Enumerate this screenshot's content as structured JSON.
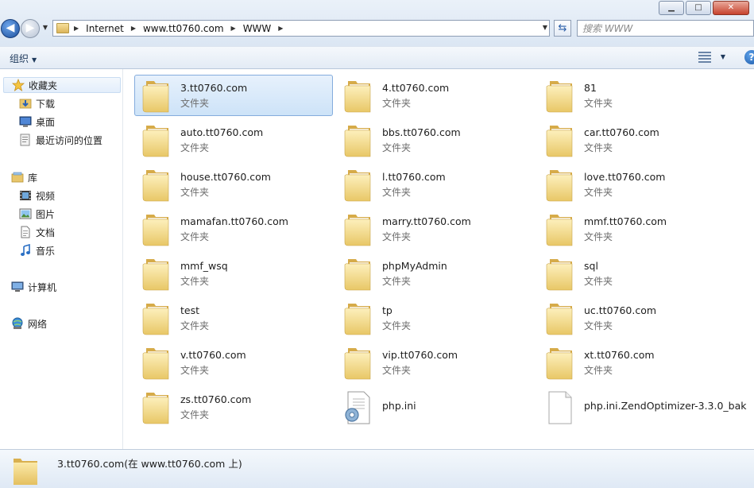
{
  "address_bar": {
    "breadcrumbs": [
      "Internet",
      "www.tt0760.com",
      "WWW"
    ],
    "search_placeholder": "搜索 WWW"
  },
  "toolbar": {
    "organize_label": "组织"
  },
  "sidebar": {
    "items": [
      {
        "label": "收藏夹",
        "icon": "star-icon"
      },
      {
        "label": "下载",
        "icon": "download-folder-icon"
      },
      {
        "label": "桌面",
        "icon": "desktop-icon"
      },
      {
        "label": "最近访问的位置",
        "icon": "recent-places-icon"
      },
      {
        "label": "库",
        "icon": "library-icon"
      },
      {
        "label": "视频",
        "icon": "video-icon"
      },
      {
        "label": "图片",
        "icon": "pictures-icon"
      },
      {
        "label": "文档",
        "icon": "documents-icon"
      },
      {
        "label": "音乐",
        "icon": "music-icon"
      },
      {
        "label": "计算机",
        "icon": "computer-icon"
      },
      {
        "label": "网络",
        "icon": "network-icon"
      }
    ]
  },
  "content": {
    "items": [
      {
        "name": "3.tt0760.com",
        "type": "文件夹",
        "kind": "folder",
        "selected": true
      },
      {
        "name": "4.tt0760.com",
        "type": "文件夹",
        "kind": "folder"
      },
      {
        "name": "81",
        "type": "文件夹",
        "kind": "folder"
      },
      {
        "name": "auto.tt0760.com",
        "type": "文件夹",
        "kind": "folder"
      },
      {
        "name": "bbs.tt0760.com",
        "type": "文件夹",
        "kind": "folder"
      },
      {
        "name": "car.tt0760.com",
        "type": "文件夹",
        "kind": "folder"
      },
      {
        "name": "house.tt0760.com",
        "type": "文件夹",
        "kind": "folder"
      },
      {
        "name": "l.tt0760.com",
        "type": "文件夹",
        "kind": "folder"
      },
      {
        "name": "love.tt0760.com",
        "type": "文件夹",
        "kind": "folder"
      },
      {
        "name": "mamafan.tt0760.com",
        "type": "文件夹",
        "kind": "folder"
      },
      {
        "name": "marry.tt0760.com",
        "type": "文件夹",
        "kind": "folder"
      },
      {
        "name": "mmf.tt0760.com",
        "type": "文件夹",
        "kind": "folder"
      },
      {
        "name": "mmf_wsq",
        "type": "文件夹",
        "kind": "folder"
      },
      {
        "name": "phpMyAdmin",
        "type": "文件夹",
        "kind": "folder"
      },
      {
        "name": "sql",
        "type": "文件夹",
        "kind": "folder"
      },
      {
        "name": "test",
        "type": "文件夹",
        "kind": "folder"
      },
      {
        "name": "tp",
        "type": "文件夹",
        "kind": "folder"
      },
      {
        "name": "uc.tt0760.com",
        "type": "文件夹",
        "kind": "folder"
      },
      {
        "name": "v.tt0760.com",
        "type": "文件夹",
        "kind": "folder"
      },
      {
        "name": "vip.tt0760.com",
        "type": "文件夹",
        "kind": "folder"
      },
      {
        "name": "xt.tt0760.com",
        "type": "文件夹",
        "kind": "folder"
      },
      {
        "name": "zs.tt0760.com",
        "type": "文件夹",
        "kind": "folder"
      },
      {
        "name": "php.ini",
        "type": "",
        "kind": "ini-file"
      },
      {
        "name": "php.ini.ZendOptimizer-3.3.0_bak",
        "type": "",
        "kind": "blank-file"
      }
    ]
  },
  "details": {
    "text": "3.tt0760.com(在 www.tt0760.com 上)"
  }
}
